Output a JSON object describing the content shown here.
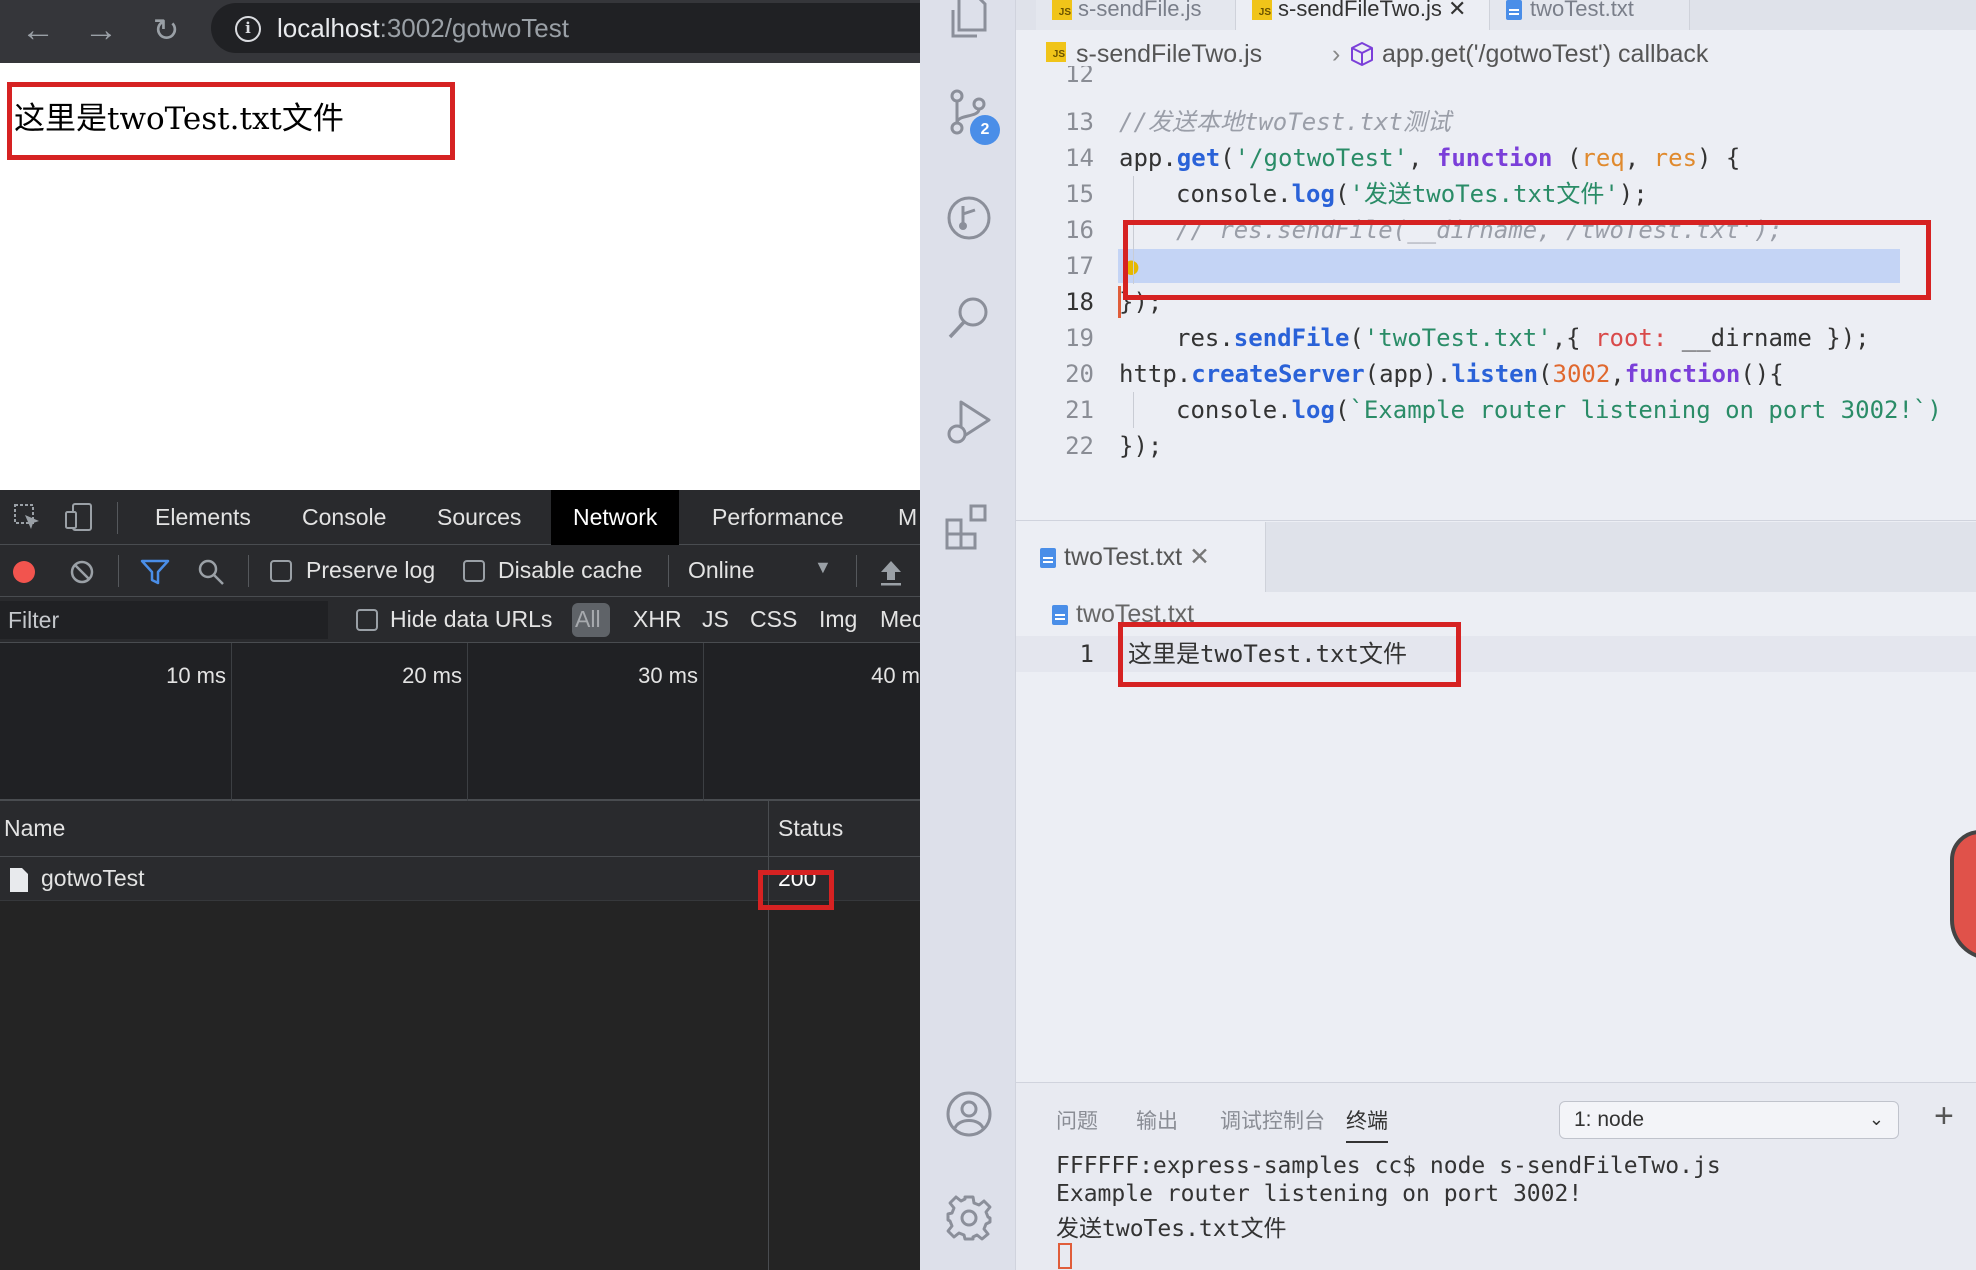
{
  "browser": {
    "url_host": "localhost",
    "url_path": ":3002/gotwoTest",
    "page_text": "这里是twoTest.txt文件"
  },
  "devtools": {
    "tabs": [
      "Elements",
      "Console",
      "Sources",
      "Network",
      "Performance",
      "M"
    ],
    "active_tab": "Network",
    "toolbar": {
      "preserve_log": "Preserve log",
      "disable_cache": "Disable cache",
      "throttle": "Online"
    },
    "filter": {
      "placeholder": "Filter",
      "hide_data_urls": "Hide data URLs",
      "types": [
        "All",
        "XHR",
        "JS",
        "CSS",
        "Img",
        "Med"
      ]
    },
    "timeline_labels": [
      "10 ms",
      "20 ms",
      "30 ms",
      "40 m"
    ],
    "columns": {
      "name": "Name",
      "status": "Status"
    },
    "rows": [
      {
        "name": "gotwoTest",
        "status": "200"
      }
    ]
  },
  "vscode": {
    "tabs": [
      "s-sendFile.js",
      "s-sendFileTwo.js",
      "twoTest.txt"
    ],
    "breadcrumb": {
      "file": "s-sendFileTwo.js",
      "symbol": "app.get('/gotwoTest') callback"
    },
    "line_numbers": [
      "12",
      "13",
      "14",
      "15",
      "16",
      "17",
      "18",
      "19",
      "20",
      "21",
      "22"
    ],
    "code": {
      "l13": "//发送本地twoTest.txt测试",
      "l14_obj": "app.",
      "l14_fn": "get",
      "l14_str": "'/gotwoTest'",
      "l14_kw": "function",
      "l14_p1": "req",
      "l14_p2": "res",
      "l15_obj": "console.",
      "l15_fn": "log",
      "l15_str": "'发送twoTes.txt文件'",
      "l16": "// res.sendFile(__dirname, /twoTest.txt');",
      "l17_obj": "res.",
      "l17_fn": "sendFile",
      "l17_str": "'twoTest.txt'",
      "l17_prop": "root:",
      "l17_rest": "__dirname });",
      "l18": "});",
      "l20_obj": "http.",
      "l20_fn": "createServer",
      "l20_mid": "(app).",
      "l20_fn2": "listen",
      "l20_num": "3002",
      "l20_kw": "function",
      "l21_obj": "console.",
      "l21_fn": "log",
      "l21_str": "`Example router listening on port 3002!`)",
      "l22": "});"
    },
    "file_tab": "twoTest.txt",
    "file_breadcrumb": "twoTest.txt",
    "file_line_number": "1",
    "file_content": "这里是twoTest.txt文件",
    "scm_badge": "2",
    "terminal": {
      "tabs": [
        "问题",
        "输出",
        "调试控制台",
        "终端"
      ],
      "active_tab": "终端",
      "select_value": "1: node",
      "lines": [
        "FFFFFF:express-samples cc$ node s-sendFileTwo.js",
        "Example router listening on port 3002!",
        "发送twoTes.txt文件"
      ]
    }
  },
  "colors": {
    "highlight_red": "#d62222",
    "record_red": "#f2544e",
    "accent_blue": "#4a8ee8"
  }
}
